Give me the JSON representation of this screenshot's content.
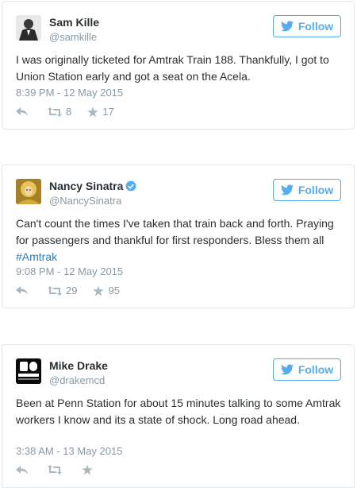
{
  "colors": {
    "accent": "#55acee",
    "link": "#2b7bb9",
    "muted": "#8899a6",
    "border": "#e1e8ed"
  },
  "tweets": [
    {
      "name": "Sam Kille",
      "handle": "@samkille",
      "verified": false,
      "text": "I was originally ticketed for Amtrak Train 188. Thankfully, I got to Union Station early and got a seat on the Acela.",
      "hashtag": "",
      "timestamp": "8:39 PM - 12 May 2015",
      "retweets": "8",
      "favorites": "17",
      "follow_label": "Follow"
    },
    {
      "name": "Nancy Sinatra",
      "handle": "@NancySinatra",
      "verified": true,
      "text": "Can't count the times I've taken that train back and forth. Praying for passengers and thankful for first responders. Bless them all",
      "hashtag": "#Amtrak",
      "timestamp": "9:08 PM - 12 May 2015",
      "retweets": "29",
      "favorites": "95",
      "follow_label": "Follow"
    },
    {
      "name": "Mike Drake",
      "handle": "@drakemcd",
      "verified": false,
      "text": "Been at Penn Station for about 15 minutes talking to some Amtrak workers I know and its a state of shock. Long road ahead.",
      "hashtag": "",
      "timestamp": "3:38 AM - 13 May 2015",
      "retweets": "",
      "favorites": "",
      "follow_label": "Follow"
    }
  ]
}
